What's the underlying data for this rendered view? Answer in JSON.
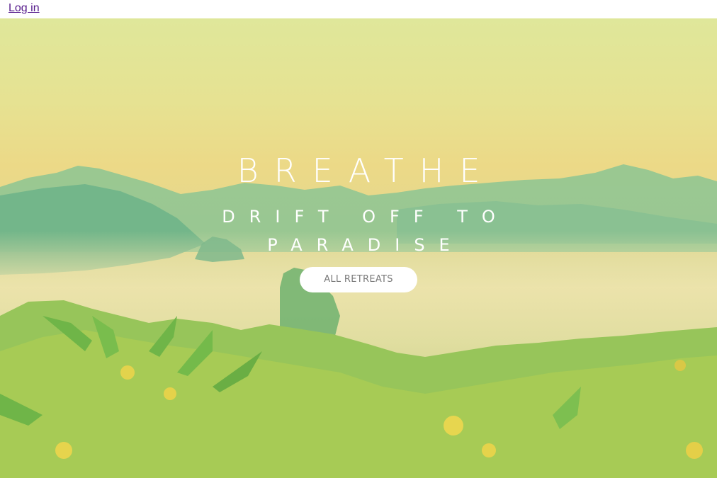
{
  "nav": {
    "login_label": "Log in"
  },
  "hero": {
    "title": "BREATHE",
    "subtitle": "DRIFT OFF TO PARADISE",
    "cta_label": "ALL RETREATS"
  },
  "colors": {
    "link": "#551a8b",
    "hero_text": "#ffffff",
    "button_bg": "#ffffff",
    "button_text": "#7a7a7a"
  }
}
